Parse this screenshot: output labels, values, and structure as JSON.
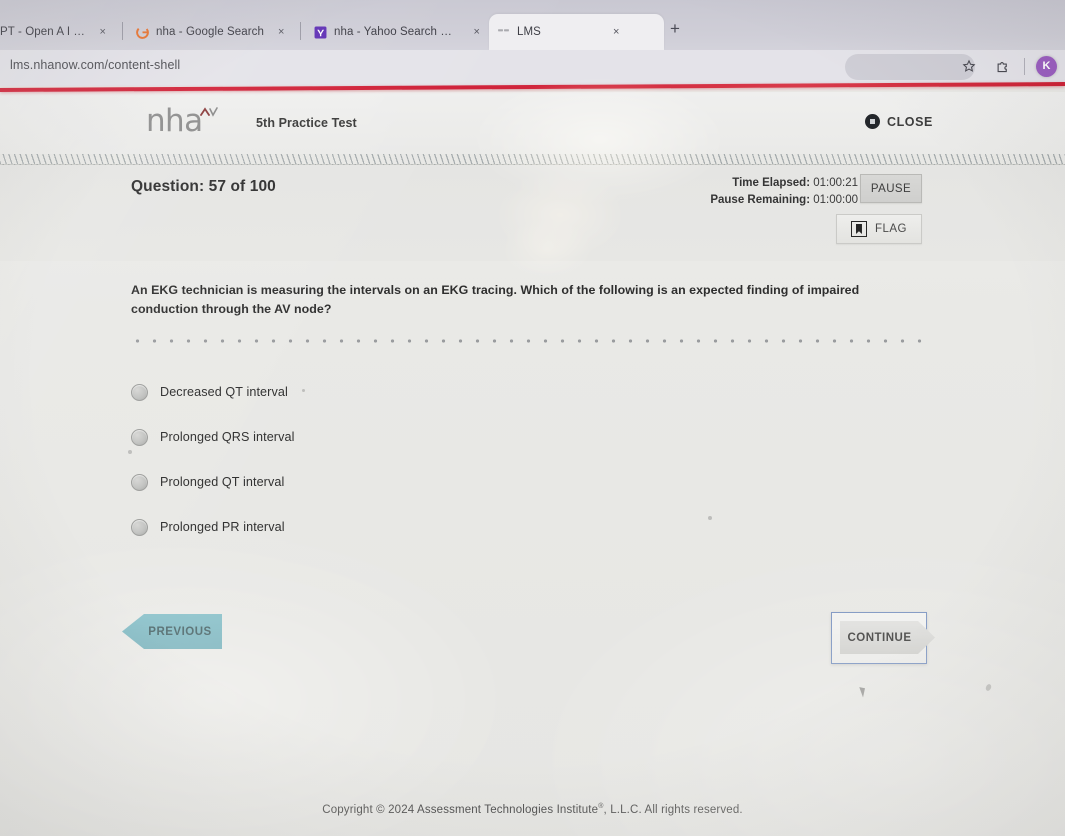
{
  "browser": {
    "tabs": [
      {
        "label": "PT - Open A I Gpt 3.5",
        "favicon": "none",
        "active": false,
        "close": "×"
      },
      {
        "label": "nha - Google Search",
        "favicon": "google-icon",
        "active": false,
        "close": "×"
      },
      {
        "label": "nha - Yahoo Search Results",
        "favicon": "yahoo-icon",
        "active": false,
        "close": "×"
      },
      {
        "label": "LMS",
        "favicon": "lms-icon",
        "active": true,
        "close": "×"
      }
    ],
    "new_tab_label": "+",
    "url": "lms.nhanow.com/content-shell",
    "profile_initial": "K"
  },
  "app": {
    "logo_text": "nha",
    "title": "5th Practice Test",
    "close_label": "CLOSE"
  },
  "exam": {
    "question_label": "Question: 57 of 100",
    "time_elapsed_label": "Time Elapsed:",
    "time_elapsed_value": "01:00:21",
    "pause_remaining_label": "Pause Remaining:",
    "pause_remaining_value": "01:00:00",
    "pause_button": "PAUSE",
    "flag_button": "FLAG",
    "question_text": "An EKG technician is measuring the intervals on an EKG tracing. Which of the following is an expected finding of impaired conduction through the AV node?",
    "options": [
      {
        "label": "Decreased QT interval",
        "selected": false
      },
      {
        "label": "Prolonged QRS interval",
        "selected": false
      },
      {
        "label": "Prolonged QT interval",
        "selected": false
      },
      {
        "label": "Prolonged PR interval",
        "selected": false
      }
    ],
    "previous_button": "PREVIOUS",
    "continue_button": "CONTINUE"
  },
  "footer": {
    "copyright_pre": "Copyright © 2024 Assessment Technologies Institute",
    "copyright_sup": "®",
    "copyright_post": ", L.L.C. All rights reserved."
  },
  "colors": {
    "accent_teal": "#6eb2bd",
    "accent_red": "#d2243a",
    "avatar_purple": "#9b5fc0",
    "page_bg": "#e9e9e6"
  }
}
